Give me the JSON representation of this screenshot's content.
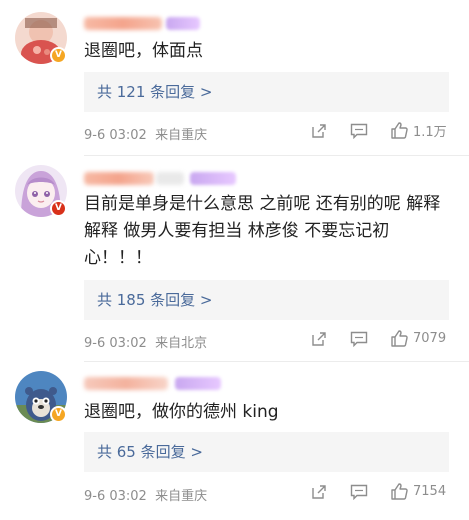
{
  "comments": [
    {
      "text": "退圈吧，体面点",
      "replies_label": "共 121 条回复 >",
      "time": "9-6 03:02",
      "source": "来自重庆",
      "likes": "1.1万",
      "badge": "V"
    },
    {
      "text": "目前是单身是什么意思 之前呢 还有别的呢 解释解释 做男人要有担当 林彦俊 不要忘记初心！！！",
      "replies_label": "共 185 条回复 >",
      "time": "9-6 03:02",
      "source": "来自北京",
      "likes": "7079",
      "badge": "V"
    },
    {
      "text": "退圈吧，做你的德州 king",
      "replies_label": "共 65 条回复 >",
      "time": "9-6 03:02",
      "source": "来自重庆",
      "likes": "7154",
      "badge": "V"
    }
  ],
  "colors": {
    "link": "#4a6a9a",
    "meta": "#8d8d8d",
    "badge_yellow": "#f5a623",
    "badge_red": "#d8311a"
  }
}
